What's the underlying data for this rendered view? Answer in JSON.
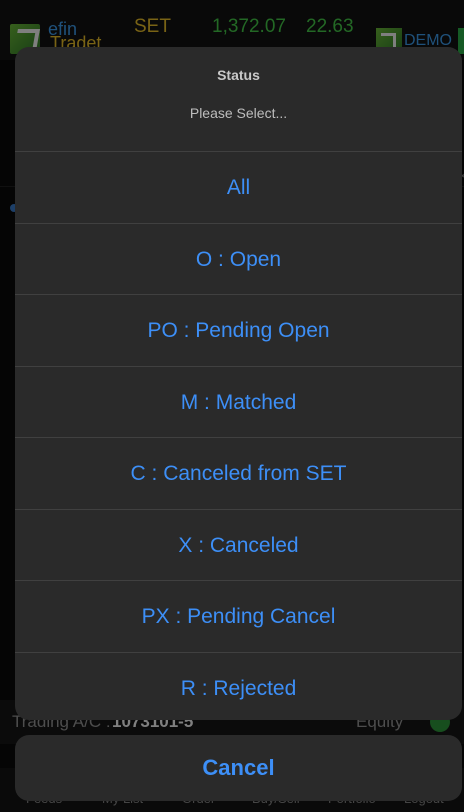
{
  "header": {
    "logo_line1": "efin",
    "logo_line2": "Tradet",
    "index_name": "SET",
    "index_value": "1,372.07",
    "index_change": "22.63",
    "demo_label": "DEMO"
  },
  "account_bar": {
    "trading_label": "Trading A/C :",
    "trading_value": "1073101-5",
    "equity_label": "Equity"
  },
  "tabbar": {
    "items": [
      "Feeds",
      "My List",
      "Order",
      "Buy/Sell",
      "Portfolio",
      "Logout"
    ]
  },
  "sheet": {
    "title": "Status",
    "subtitle": "Please Select...",
    "options": [
      "All",
      "O : Open",
      "PO : Pending Open",
      "M : Matched",
      "C : Canceled from SET",
      "X : Canceled",
      "PX : Pending Cancel",
      "R : Rejected"
    ],
    "cancel_label": "Cancel"
  },
  "colors": {
    "accent": "#3d8ff7",
    "positive": "#47d14a",
    "index_name": "#f2c62b",
    "sheet_bg": "#2a2a2a"
  }
}
